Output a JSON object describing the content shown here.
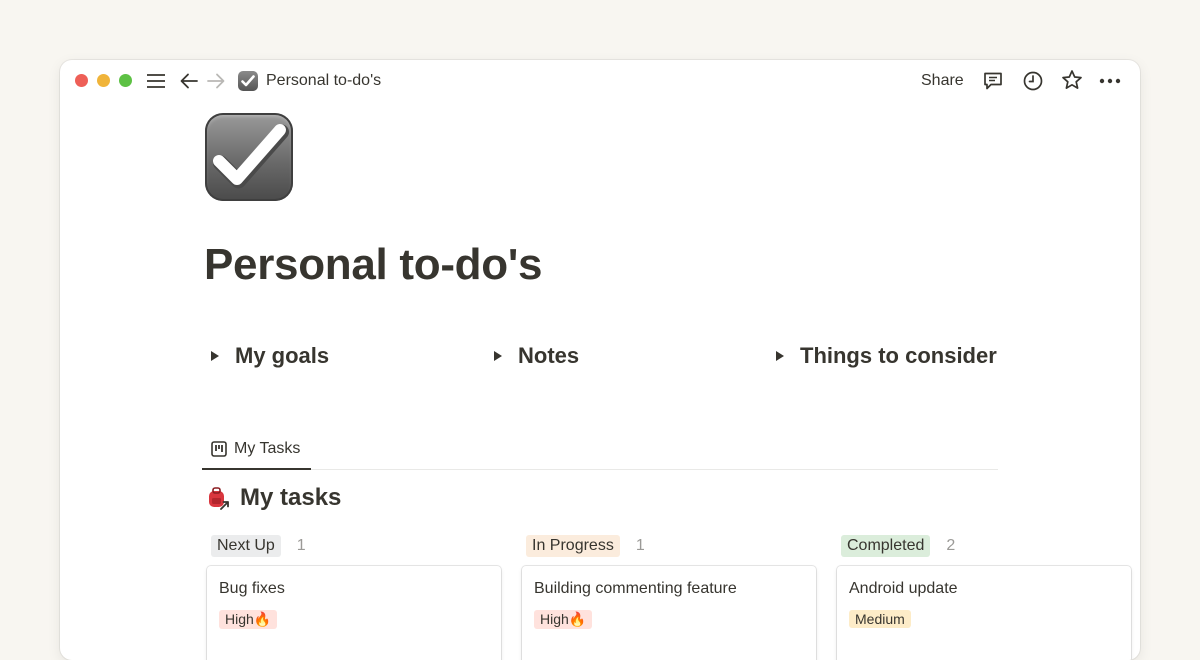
{
  "window": {
    "breadcrumb_title": "Personal to-do's",
    "share_label": "Share",
    "icons": [
      "menu-icon",
      "back-arrow-icon",
      "forward-arrow-icon",
      "checkbox-icon",
      "comment-icon",
      "history-clock-icon",
      "star-icon",
      "more-icon"
    ]
  },
  "page": {
    "title": "Personal to-do's",
    "icon": "heavy-check-mark-icon"
  },
  "toggles": [
    {
      "label": "My goals"
    },
    {
      "label": "Notes"
    },
    {
      "label": "Things to consider"
    }
  ],
  "view_tab": {
    "label": "My Tasks",
    "icon": "board-icon"
  },
  "database": {
    "title": "My tasks",
    "icon": "backpack-link-icon"
  },
  "groups": [
    {
      "name": "Next Up",
      "count": "1",
      "color": "#ebeced",
      "cards": [
        {
          "title": "Bug fixes",
          "tag": "High🔥",
          "tag_color": "#ffe2dd"
        }
      ]
    },
    {
      "name": "In Progress",
      "count": "1",
      "color": "#fbecdd",
      "cards": [
        {
          "title": "Building commenting feature",
          "tag": "High🔥",
          "tag_color": "#ffe2dd"
        }
      ]
    },
    {
      "name": "Completed",
      "count": "2",
      "color": "#dbeddb",
      "cards": [
        {
          "title": "Android update",
          "tag": "Medium",
          "tag_color": "#fdecc8"
        }
      ]
    }
  ],
  "colors": {
    "text": "#37352f",
    "background": "#f8f6f1",
    "traffic_red": "#ee5f57",
    "traffic_yellow": "#f0b43a",
    "traffic_green": "#5dc144"
  }
}
